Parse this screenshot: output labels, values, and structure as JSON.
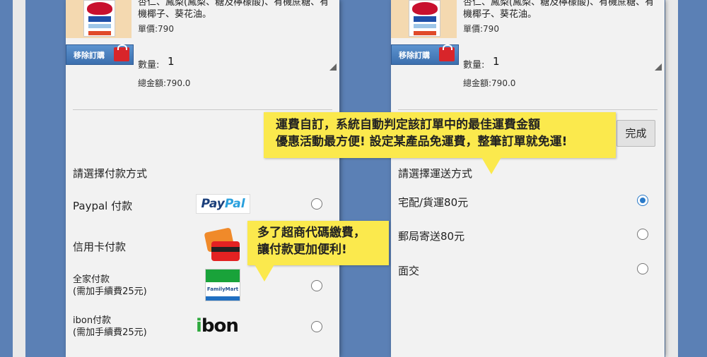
{
  "product": {
    "desc_line1": "杏仁、鳳梨(鳳梨、糖及檸檬酸)、有機蔗糖、有",
    "desc_line2": "機椰子、葵花油。",
    "price": "單價:790",
    "remove_label": "移除訂購",
    "qty_label": "數量:",
    "qty_value": "1",
    "total": "總金額:790.0"
  },
  "payment": {
    "title": "請選擇付款方式",
    "options": [
      {
        "label": "Paypal 付款",
        "icon": "paypal-logo",
        "logo_text_1": "Pay",
        "logo_text_2": "Pal"
      },
      {
        "label": "信用卡付款",
        "icon": "credit-card-icon"
      },
      {
        "label": "全家付款",
        "note": "(需加手續費25元)",
        "icon": "familymart-logo",
        "logo_text": "FamilyMart"
      },
      {
        "label": "ibon付款",
        "note": "(需加手續費25元)",
        "icon": "ibon-logo",
        "logo_text_1": "i",
        "logo_text_2": "bon"
      }
    ]
  },
  "shipping": {
    "title": "請選擇運送方式",
    "done_label": "完成",
    "options": [
      {
        "label": "宅配/貨運80元",
        "selected": true
      },
      {
        "label": "郵局寄送80元",
        "selected": false
      },
      {
        "label": "面交",
        "selected": false
      }
    ]
  },
  "callouts": {
    "shipping_line1": "運費自訂，系統自動判定該訂單中的最佳運費金額",
    "shipping_line2": "優惠活動最方便! 設定某產品免運費，整筆訂單就免運!",
    "payment_line1": "多了超商代碼繳費，",
    "payment_line2": "讓付款更加便利!"
  },
  "colors": {
    "background": "#5b80b5",
    "callout": "#fbe94d",
    "accent": "#2a7ac9"
  }
}
